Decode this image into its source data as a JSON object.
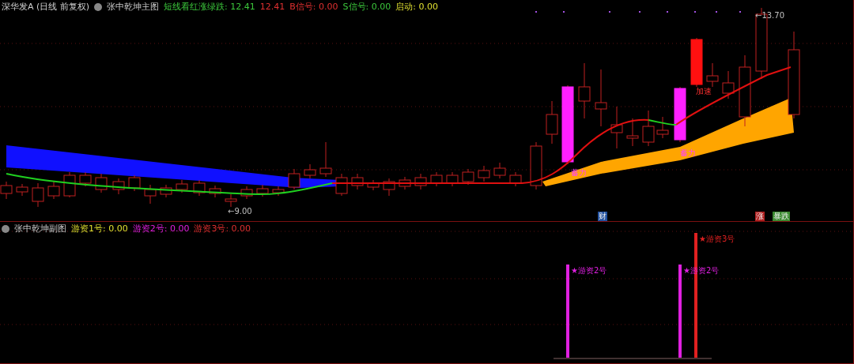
{
  "main_panel": {
    "title": "深华发A (日线 前复权)",
    "indicator": "张中乾坤主图",
    "legend": [
      {
        "label": "短线看红涨绿跌:",
        "value": "12.41",
        "color": "#3cc83c"
      },
      {
        "value": "12.41",
        "color": "#e03030"
      },
      {
        "label": "B信号:",
        "value": "0.00",
        "color": "#e03030"
      },
      {
        "label": "S信号:",
        "value": "0.00",
        "color": "#3cc83c"
      },
      {
        "label": "启动:",
        "value": "0.00",
        "color": "#e0e030"
      }
    ],
    "annotations": [
      {
        "kind": "price",
        "text": "←13.70"
      },
      {
        "kind": "price",
        "text": "←9.00"
      },
      {
        "kind": "label",
        "text": "蓄力"
      },
      {
        "kind": "label",
        "text": "蓄力"
      },
      {
        "kind": "label",
        "text": "加速"
      }
    ],
    "markers": [
      {
        "text": "财",
        "color": "#2050a0"
      },
      {
        "text": "涨",
        "color": "#b02020"
      },
      {
        "text": "暴跌",
        "color": "#3a8a30"
      }
    ]
  },
  "sub_panel": {
    "indicator": "张中乾坤副图",
    "legend": [
      {
        "label": "游资1号:",
        "value": "0.00",
        "color": "#e0e030"
      },
      {
        "label": "游资2号:",
        "value": "0.00",
        "color": "#e020e0"
      },
      {
        "label": "游资3号:",
        "value": "0.00",
        "color": "#e03030"
      }
    ],
    "signals": [
      {
        "text": "★游资2号",
        "color": "#e020e0"
      },
      {
        "text": "★游资2号",
        "color": "#e020e0"
      },
      {
        "text": "★游资3号",
        "color": "#e02020"
      }
    ]
  }
}
